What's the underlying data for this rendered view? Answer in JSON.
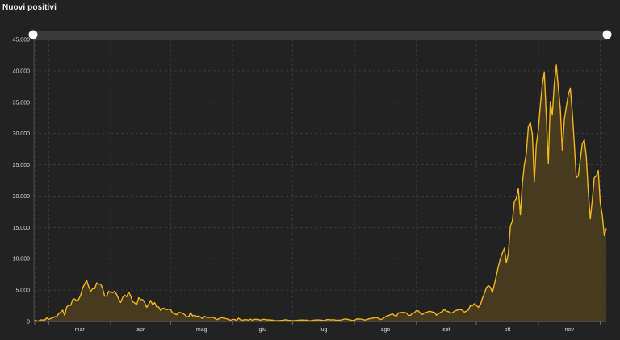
{
  "chart_data": {
    "type": "area",
    "title": "Nuovi positivi",
    "xlabel": "",
    "ylabel": "",
    "ylim": [
      0,
      45000
    ],
    "y_ticks": [
      0,
      5000,
      10000,
      15000,
      20000,
      25000,
      30000,
      35000,
      40000,
      45000
    ],
    "y_tick_labels": [
      "0",
      "5.000",
      "10.000",
      "15.000",
      "20.000",
      "25.000",
      "30.000",
      "35.000",
      "40.000",
      "45.000"
    ],
    "x_months": [
      "mar",
      "apr",
      "mag",
      "giu",
      "lug",
      "ago",
      "set",
      "ott",
      "nov"
    ],
    "grid": true,
    "line_color": "#f2b51c",
    "fill_color": "#4d3f1f",
    "series": [
      {
        "values": [
          221,
          93,
          78,
          250,
          238,
          240,
          566,
          342,
          466,
          587,
          769,
          778,
          1247,
          1492,
          1797,
          977,
          2313,
          2651,
          2547,
          3497,
          3590,
          3233,
          3526,
          4207,
          5322,
          5986,
          6557,
          5560,
          4789,
          5249,
          5210,
          6153,
          5959,
          5974,
          5217,
          4050,
          4053,
          4782,
          4668,
          4585,
          4805,
          4316,
          3599,
          3039,
          3836,
          4204,
          3951,
          4694,
          4092,
          3153,
          2972,
          2667,
          3786,
          3493,
          3491,
          3047,
          2256,
          2729,
          3370,
          2646,
          3021,
          2357,
          2324,
          1739,
          2091,
          2086,
          1872,
          1965,
          1900,
          1389,
          1221,
          1075,
          1444,
          1401,
          1327,
          1083,
          802,
          744,
          1402,
          888,
          992,
          789,
          875,
          675,
          451,
          813,
          665,
          642,
          652,
          669,
          531,
          300,
          397,
          584,
          593,
          516,
          416,
          355,
          178,
          318,
          321,
          177,
          518,
          270,
          197,
          280,
          283,
          202,
          379,
          163,
          346,
          338,
          301,
          210,
          329,
          333,
          251,
          264,
          224,
          221,
          113,
          136,
          126,
          175,
          174,
          255,
          259,
          175,
          174,
          126,
          142,
          162,
          201,
          223,
          235,
          192,
          208,
          138,
          114,
          163,
          230,
          233,
          249,
          219,
          190,
          129,
          282,
          306,
          252,
          275,
          255,
          170,
          212,
          202,
          289,
          386,
          379,
          295,
          238,
          159,
          190,
          384,
          401,
          379,
          347,
          239,
          274,
          412,
          481,
          523,
          574,
          629,
          479,
          320,
          403,
          642,
          845,
          947,
          1071,
          1210,
          953,
          878,
          1367,
          1411,
          1460,
          1444,
          1365,
          996,
          978,
          1326,
          1397,
          1733,
          1695,
          1297,
          1108,
          1370,
          1434,
          1597,
          1616,
          1501,
          1458,
          1008,
          1229,
          1452,
          1585,
          1907,
          1638,
          1587,
          1350,
          1392,
          1640,
          1786,
          1869,
          1912,
          1766,
          1494,
          1648,
          1851,
          2548,
          2499,
          2844,
          2578,
          2257,
          2677,
          3678,
          4458,
          5372,
          5724,
          5456,
          4619,
          5901,
          7332,
          8804,
          10010,
          10925,
          11705,
          9338,
          10874,
          15199,
          16079,
          19143,
          19644,
          21273,
          17012,
          21994,
          24991,
          26831,
          31084,
          31758,
          29907,
          22253,
          28244,
          30550,
          34505,
          37809,
          39811,
          32616,
          25271,
          35098,
          32961,
          37978,
          40902,
          37255,
          33979,
          27354,
          32191,
          34283,
          36176,
          37242,
          33357,
          28337,
          22930,
          23232,
          25853,
          28352,
          29003,
          26323,
          20648,
          16377,
          19350,
          22930,
          23225,
          24099,
          18887,
          16999,
          13720,
          14844
        ]
      }
    ]
  }
}
